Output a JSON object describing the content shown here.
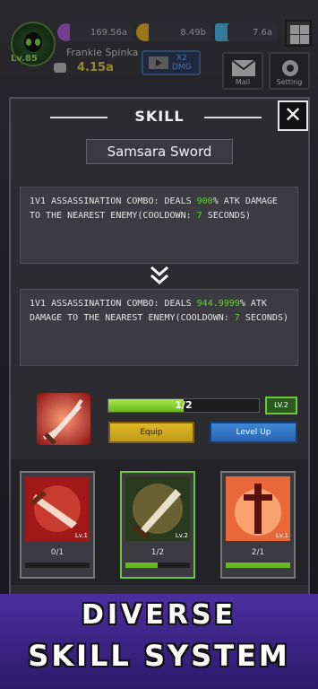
{
  "hud": {
    "level": "Lv.85",
    "resource_1": "169.56a",
    "resource_2": "8.49b",
    "resource_3": "7.6a",
    "player_name": "Frankie Spinka",
    "power": "4.15a",
    "dmg_boost": "X2\nDMG",
    "mail_label": "Mail",
    "setting_label": "Setting"
  },
  "panel": {
    "title": "SKILL",
    "skill_name": "Samsara Sword",
    "current_desc": {
      "prefix": "1V1 ASSASSINATION COMBO: DEALS ",
      "value": "900",
      "middle": "% ATK DAMAGE TO THE NEAREST ENEMY(COOLDOWN: ",
      "cooldown": "7",
      "suffix": " SECONDS)"
    },
    "next_desc": {
      "prefix": "1V1 ASSASSINATION COMBO: DEALS ",
      "value": "944.9999",
      "middle": "% ATK DAMAGE TO THE NEAREST ENEMY(COOLDOWN: ",
      "cooldown": "7",
      "suffix": " SECONDS)"
    },
    "progress_text": "1/2",
    "progress_fraction": 0.5,
    "level_badge": "LV.2",
    "equip_label": "Equip",
    "levelup_label": "Level Up"
  },
  "cards": [
    {
      "count": "0/1",
      "level": "Lv.1",
      "fill": 0.0
    },
    {
      "count": "1/2",
      "level": "Lv.2",
      "fill": 0.5
    },
    {
      "count": "2/1",
      "level": "Lv.1",
      "fill": 1.0
    }
  ],
  "banner": {
    "line1": "DIVERSE",
    "line2": "SKILL SYSTEM"
  },
  "colors": {
    "highlight": "#6ec84a",
    "banner": "#3a2484",
    "equip": "#d6ad22",
    "levelup": "#3478c8"
  }
}
